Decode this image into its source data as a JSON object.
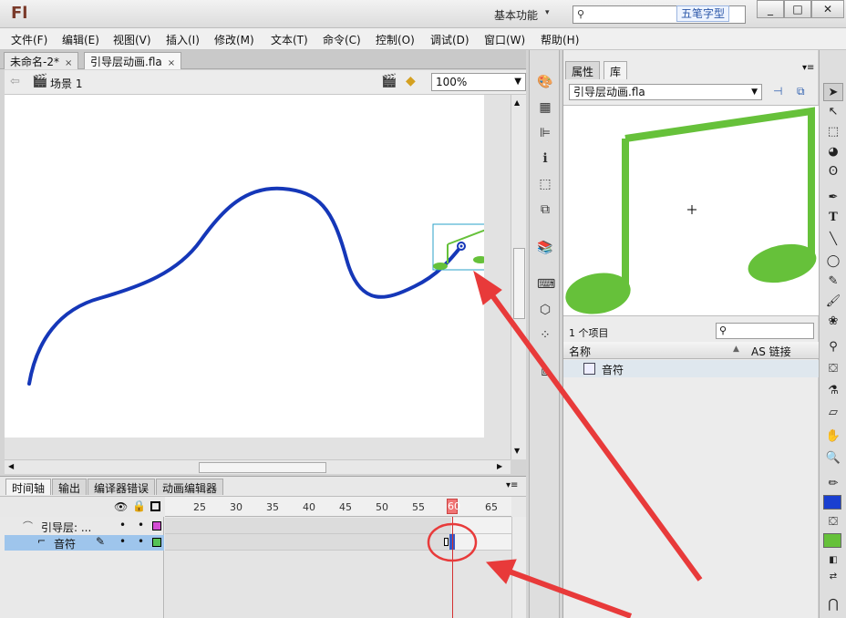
{
  "app": {
    "logo": "Fl",
    "workspace": "基本功能",
    "search_placeholder": "",
    "ime_badge": "五笔字型",
    "win_buttons": [
      "_",
      "□",
      "✕"
    ]
  },
  "menu": [
    "文件(F)",
    "编辑(E)",
    "视图(V)",
    "插入(I)",
    "修改(M)",
    "文本(T)",
    "命令(C)",
    "控制(O)",
    "调试(D)",
    "窗口(W)",
    "帮助(H)"
  ],
  "doc_tabs": [
    {
      "label": "未命名-2*",
      "close": "×"
    },
    {
      "label": "引导层动画.fla",
      "close": "×"
    }
  ],
  "editbar": {
    "scene": "场景 1",
    "zoom": "100%"
  },
  "timeline": {
    "tabs": [
      "时间轴",
      "输出",
      "编译器错误",
      "动画编辑器"
    ],
    "ruler": [
      "25",
      "30",
      "35",
      "40",
      "45",
      "50",
      "55",
      "60",
      "65"
    ],
    "current_frame": "60",
    "layers": [
      {
        "name": "引导层: ...",
        "color": "#d44cd4"
      },
      {
        "name": "音符",
        "color": "#55c255"
      }
    ]
  },
  "library": {
    "tabs": [
      "属性",
      "库"
    ],
    "document": "引导层动画.fla",
    "item_count": "1 个项目",
    "col_name": "名称",
    "col_linkage": "AS 链接",
    "items": [
      "音符"
    ]
  },
  "colors": {
    "stroke": "#1a3fd0",
    "fill": "#2a4fe0",
    "guide_path": "#1537b8",
    "note": "#66c13a",
    "arrow": "#e83a3a"
  }
}
